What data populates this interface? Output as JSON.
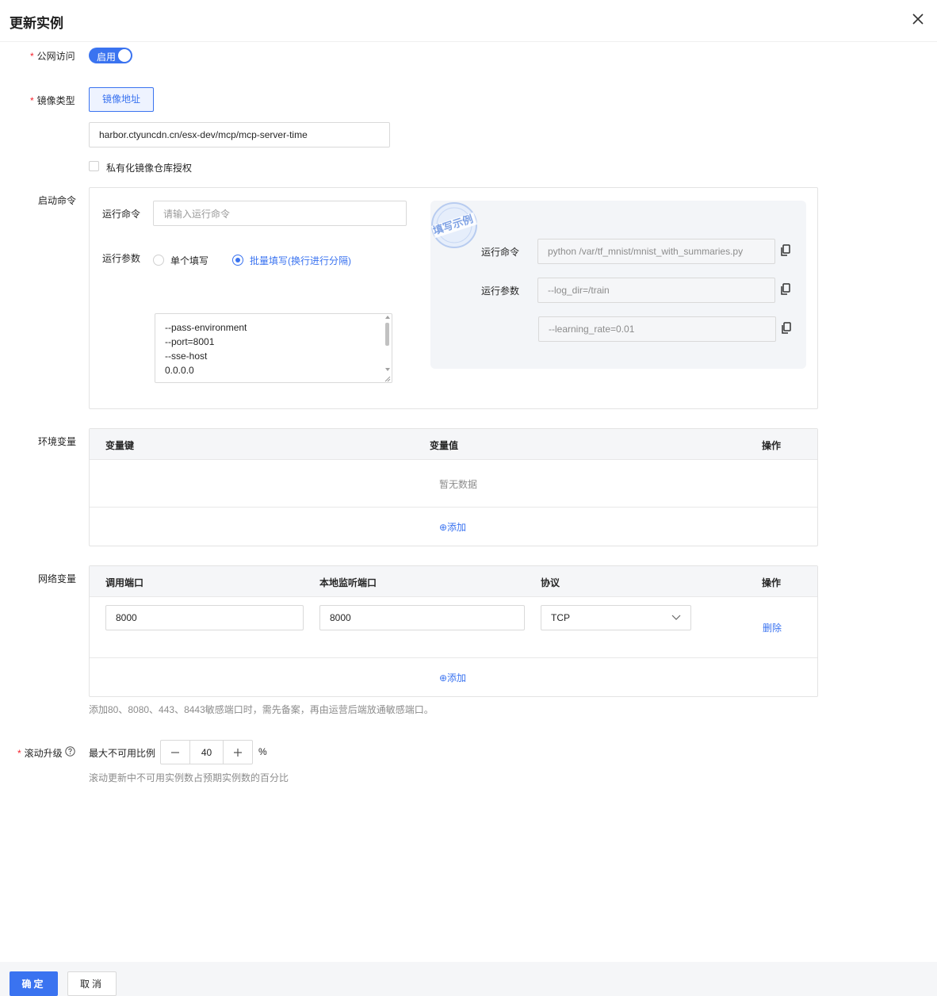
{
  "dialog": {
    "title": "更新实例"
  },
  "public_access": {
    "label": "公网访问",
    "toggle_text": "启用"
  },
  "image_type": {
    "label": "镜像类型",
    "option": "镜像地址",
    "address_value": "harbor.ctyuncdn.cn/esx-dev/mcp/mcp-server-time",
    "private_repo_label": "私有化镜像仓库授权"
  },
  "startup": {
    "label": "启动命令",
    "run_command_label": "运行命令",
    "run_command_placeholder": "请输入运行命令",
    "run_args_label": "运行参数",
    "mode_single": "单个填写",
    "mode_batch": "批量填写(换行进行分隔)",
    "args_value": "--pass-environment\n--port=8001\n--sse-host\n0.0.0.0",
    "example": {
      "stamp": "填写示例",
      "command_label": "运行命令",
      "command_value": "python /var/tf_mnist/mnist_with_summaries.py",
      "args_label": "运行参数",
      "arg1": "--log_dir=/train",
      "arg2": "--learning_rate=0.01"
    }
  },
  "env": {
    "label": "环境变量",
    "col_key": "变量键",
    "col_value": "变量值",
    "col_action": "操作",
    "empty": "暂无数据",
    "add": "⊕添加"
  },
  "network": {
    "label": "网络变量",
    "col_call_port": "调用端口",
    "col_local_port": "本地监听端口",
    "col_protocol": "协议",
    "col_action": "操作",
    "row": {
      "call_port": "8000",
      "local_port": "8000",
      "protocol": "TCP",
      "delete": "删除"
    },
    "add": "⊕添加",
    "hint": "添加80、8080、443、8443敏感端口时，需先备案，再由运营后端放通敏感端口。"
  },
  "rolling": {
    "label": "滚动升级",
    "max_unavailable_label": "最大不可用比例",
    "value": "40",
    "unit": "%",
    "hint": "滚动更新中不可用实例数占预期实例数的百分比"
  },
  "footer": {
    "confirm": "确定",
    "cancel": "取消"
  },
  "colors": {
    "primary": "#3a73f0",
    "required": "#f5222d"
  }
}
